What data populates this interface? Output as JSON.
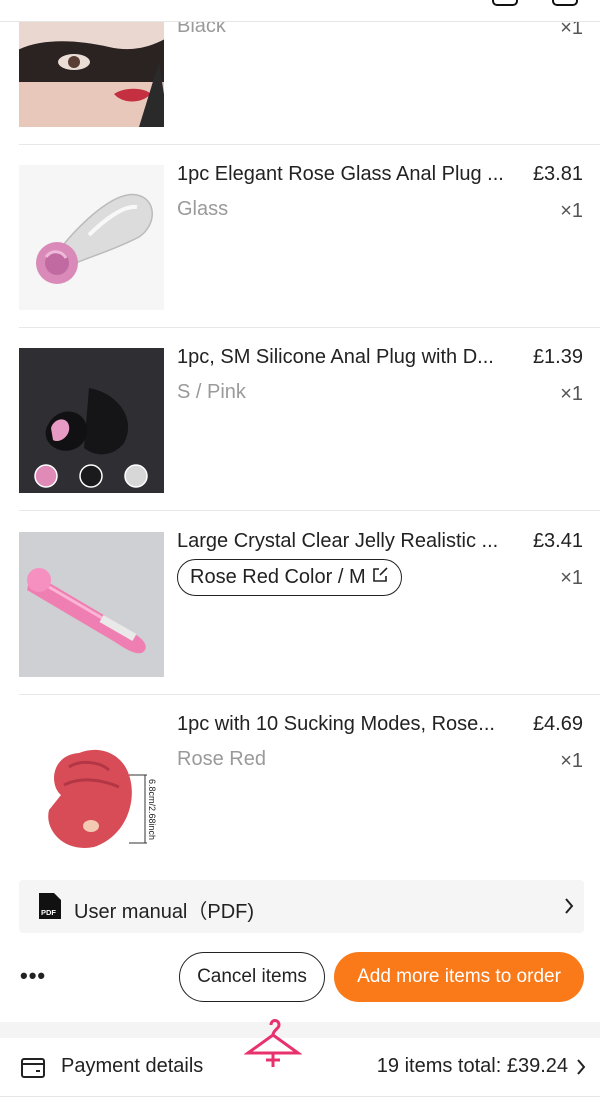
{
  "items": [
    {
      "title": "",
      "price": "",
      "variant": "Black",
      "qty": "×1"
    },
    {
      "title": "1pc Elegant Rose Glass Anal Plug ...",
      "price": "£3.81",
      "variant": "Glass",
      "qty": "×1"
    },
    {
      "title": "1pc, SM Silicone Anal Plug with D...",
      "price": "£1.39",
      "variant": "S / Pink",
      "qty": "×1"
    },
    {
      "title": "Large Crystal Clear Jelly Realistic ...",
      "price": "£3.41",
      "variant": "Rose Red Color / M",
      "qty": "×1"
    },
    {
      "title": "1pc with 10 Sucking Modes, Rose...",
      "price": "£4.69",
      "variant": "Rose Red",
      "qty": "×1"
    }
  ],
  "product_image_text": "6.8cm/2.68inch",
  "manual": {
    "label": "User manual（PDF)",
    "pdf_badge": "PDF"
  },
  "actions": {
    "more": "•••",
    "cancel": "Cancel items",
    "add_more": "Add more items to order"
  },
  "payment": {
    "label": "Payment details",
    "total": "19 items total: £39.24"
  },
  "colors": {
    "accent": "#fa7a1a",
    "hanger": "#e8326e"
  },
  "icons": {
    "manual": "pdf-file-icon",
    "edit": "edit-icon",
    "chevron": "chevron-right-icon",
    "payment": "wallet-icon",
    "watermark": "hanger-icon"
  }
}
